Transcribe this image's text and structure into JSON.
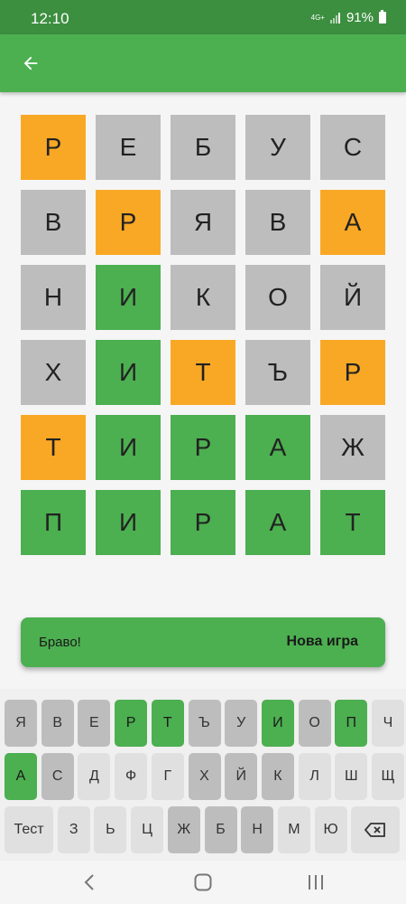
{
  "status_bar": {
    "time": "12:10",
    "network": "4G+",
    "battery": "91%"
  },
  "app_bar": {
    "back_icon": "arrow-left-icon"
  },
  "board": {
    "rows": [
      [
        {
          "letter": "Р",
          "state": "orange"
        },
        {
          "letter": "Е",
          "state": "gray"
        },
        {
          "letter": "Б",
          "state": "gray"
        },
        {
          "letter": "У",
          "state": "gray"
        },
        {
          "letter": "С",
          "state": "gray"
        }
      ],
      [
        {
          "letter": "В",
          "state": "gray"
        },
        {
          "letter": "Р",
          "state": "orange"
        },
        {
          "letter": "Я",
          "state": "gray"
        },
        {
          "letter": "В",
          "state": "gray"
        },
        {
          "letter": "А",
          "state": "orange"
        }
      ],
      [
        {
          "letter": "Н",
          "state": "gray"
        },
        {
          "letter": "И",
          "state": "green"
        },
        {
          "letter": "К",
          "state": "gray"
        },
        {
          "letter": "О",
          "state": "gray"
        },
        {
          "letter": "Й",
          "state": "gray"
        }
      ],
      [
        {
          "letter": "Х",
          "state": "gray"
        },
        {
          "letter": "И",
          "state": "green"
        },
        {
          "letter": "Т",
          "state": "orange"
        },
        {
          "letter": "Ъ",
          "state": "gray"
        },
        {
          "letter": "Р",
          "state": "orange"
        }
      ],
      [
        {
          "letter": "Т",
          "state": "orange"
        },
        {
          "letter": "И",
          "state": "green"
        },
        {
          "letter": "Р",
          "state": "green"
        },
        {
          "letter": "А",
          "state": "green"
        },
        {
          "letter": "Ж",
          "state": "gray"
        }
      ],
      [
        {
          "letter": "П",
          "state": "green"
        },
        {
          "letter": "И",
          "state": "green"
        },
        {
          "letter": "Р",
          "state": "green"
        },
        {
          "letter": "А",
          "state": "green"
        },
        {
          "letter": "Т",
          "state": "green"
        }
      ]
    ]
  },
  "snackbar": {
    "message": "Браво!",
    "action": "Нова игра"
  },
  "keyboard": {
    "rows": [
      [
        {
          "label": "Я",
          "state": "dark"
        },
        {
          "label": "В",
          "state": "dark"
        },
        {
          "label": "Е",
          "state": "dark"
        },
        {
          "label": "Р",
          "state": "green"
        },
        {
          "label": "Т",
          "state": "green"
        },
        {
          "label": "Ъ",
          "state": "dark"
        },
        {
          "label": "У",
          "state": "dark"
        },
        {
          "label": "И",
          "state": "green"
        },
        {
          "label": "О",
          "state": "dark"
        },
        {
          "label": "П",
          "state": "green"
        },
        {
          "label": "Ч",
          "state": "light"
        }
      ],
      [
        {
          "label": "А",
          "state": "green"
        },
        {
          "label": "С",
          "state": "dark"
        },
        {
          "label": "Д",
          "state": "light"
        },
        {
          "label": "Ф",
          "state": "light"
        },
        {
          "label": "Г",
          "state": "light"
        },
        {
          "label": "Х",
          "state": "dark"
        },
        {
          "label": "Й",
          "state": "dark"
        },
        {
          "label": "К",
          "state": "dark"
        },
        {
          "label": "Л",
          "state": "light"
        },
        {
          "label": "Ш",
          "state": "light"
        },
        {
          "label": "Щ",
          "state": "light"
        }
      ],
      [
        {
          "label": "Тест",
          "state": "light"
        },
        {
          "label": "З",
          "state": "light"
        },
        {
          "label": "Ь",
          "state": "light"
        },
        {
          "label": "Ц",
          "state": "light"
        },
        {
          "label": "Ж",
          "state": "dark"
        },
        {
          "label": "Б",
          "state": "dark"
        },
        {
          "label": "Н",
          "state": "dark"
        },
        {
          "label": "М",
          "state": "light"
        },
        {
          "label": "Ю",
          "state": "light"
        },
        {
          "label": "",
          "state": "light",
          "icon": "backspace-icon"
        }
      ]
    ]
  },
  "nav_bar": {
    "icons": [
      "back-icon",
      "home-icon",
      "recents-icon"
    ]
  },
  "colors": {
    "green": "#4caf50",
    "orange": "#f9a825",
    "gray": "#bdbdbd",
    "status_bar": "#3c8f3f"
  }
}
